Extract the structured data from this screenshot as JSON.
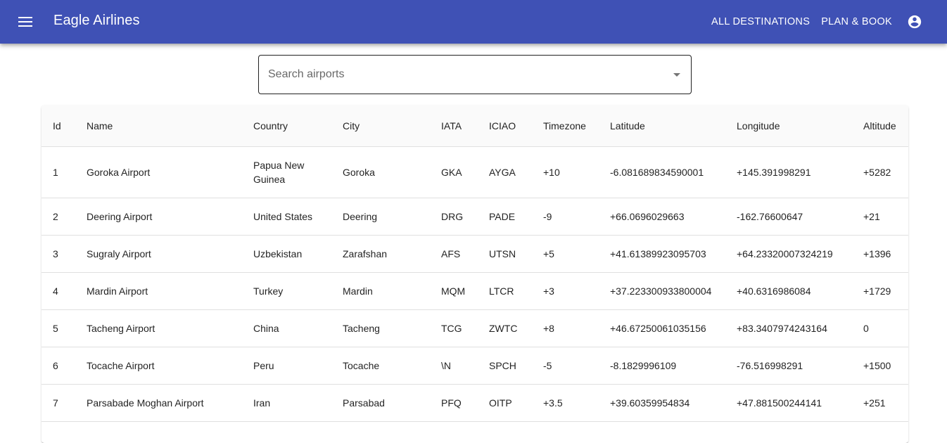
{
  "app": {
    "title": "Eagle Airlines",
    "accent_color": "#3f51b5",
    "nav": [
      "ALL DESTINATIONS",
      "PLAN & BOOK"
    ],
    "menu_icon": "menu-icon",
    "account_icon": "account-circle-icon"
  },
  "search": {
    "placeholder": "Search airports",
    "dropdown_icon": "arrow-drop-down-icon"
  },
  "table": {
    "columns": [
      "Id",
      "Name",
      "Country",
      "City",
      "IATA",
      "ICIAO",
      "Timezone",
      "Latitude",
      "Longitude",
      "Altitude"
    ],
    "rows": [
      [
        "1",
        "Goroka Airport",
        "Papua New Guinea",
        "Goroka",
        "GKA",
        "AYGA",
        "+10",
        "-6.081689834590001",
        "+145.391998291",
        "+5282"
      ],
      [
        "2",
        "Deering Airport",
        "United States",
        "Deering",
        "DRG",
        "PADE",
        "-9",
        "+66.0696029663",
        "-162.76600647",
        "+21"
      ],
      [
        "3",
        "Sugraly Airport",
        "Uzbekistan",
        "Zarafshan",
        "AFS",
        "UTSN",
        "+5",
        "+41.61389923095703",
        "+64.23320007324219",
        "+1396"
      ],
      [
        "4",
        "Mardin Airport",
        "Turkey",
        "Mardin",
        "MQM",
        "LTCR",
        "+3",
        "+37.223300933800004",
        "+40.6316986084",
        "+1729"
      ],
      [
        "5",
        "Tacheng Airport",
        "China",
        "Tacheng",
        "TCG",
        "ZWTC",
        "+8",
        "+46.67250061035156",
        "+83.3407974243164",
        "0"
      ],
      [
        "6",
        "Tocache Airport",
        "Peru",
        "Tocache",
        "\\N",
        "SPCH",
        "-5",
        "-8.1829996109",
        "-76.516998291",
        "+1500"
      ],
      [
        "7",
        "Parsabade Moghan Airport",
        "Iran",
        "Parsabad",
        "PFQ",
        "OITP",
        "+3.5",
        "+39.60359954834",
        "+47.881500244141",
        "+251"
      ]
    ]
  }
}
